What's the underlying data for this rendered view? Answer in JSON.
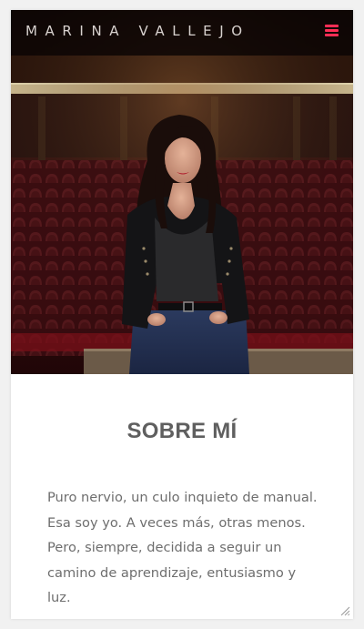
{
  "header": {
    "brand": "MARINA VALLEJO",
    "menu_icon": "hamburger-menu-icon",
    "menu_color": "#ff2e55"
  },
  "hero": {
    "image": "portrait-photo-in-theater"
  },
  "about": {
    "title": "SOBRE MÍ",
    "text": "Puro nervio, un culo inquieto de manual. Esa soy yo. A veces más, otras menos. Pero, siempre, decidida a seguir un camino de aprendizaje, entusiasmo y luz."
  },
  "colors": {
    "background": "#f1f1f1",
    "card": "#ffffff",
    "title": "#5f5f5f",
    "text": "#6e6e6e",
    "accent": "#ff2e55"
  }
}
